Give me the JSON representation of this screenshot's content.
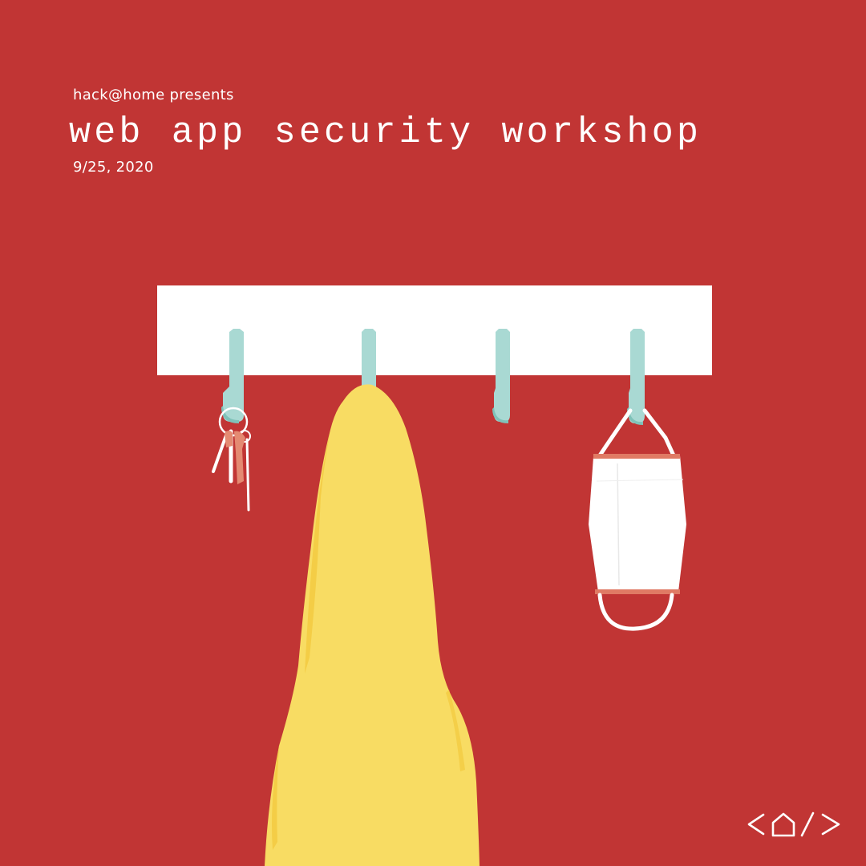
{
  "header": {
    "presenter": "hack@home presents",
    "title": "web app security workshop",
    "date": "9/25, 2020"
  },
  "colors": {
    "background": "#c13534",
    "rack": "#ffffff",
    "hooks": "#a9d9d3",
    "towel": "#f8dc63",
    "mask": "#ffffff",
    "mask_trim": "#e07a64",
    "keys": "#e48a72"
  },
  "illustration": {
    "items": [
      "coat-rack",
      "hook",
      "hook",
      "hook",
      "hook",
      "keys",
      "towel",
      "face-mask"
    ]
  },
  "logo": {
    "icon": "house-code-icon"
  }
}
